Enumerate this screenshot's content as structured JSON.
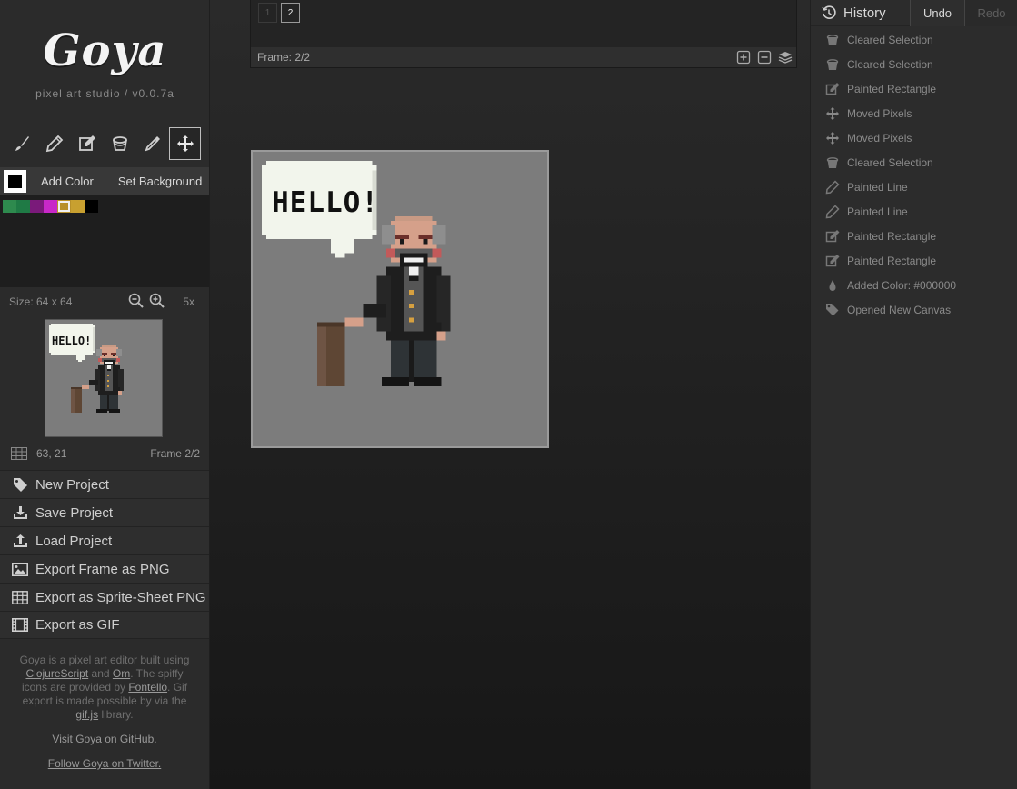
{
  "app": {
    "logo": "Goya",
    "subtitle": "pixel art studio / v0.0.7a"
  },
  "tools": [
    {
      "name": "paintbrush",
      "icon": "brush-icon",
      "active": false
    },
    {
      "name": "pencil",
      "icon": "pencil-icon",
      "active": false
    },
    {
      "name": "rectangle",
      "icon": "edit-square-icon",
      "active": false
    },
    {
      "name": "bucket",
      "icon": "bucket-icon",
      "active": false
    },
    {
      "name": "eyedropper",
      "icon": "eyedropper-icon",
      "active": false
    },
    {
      "name": "move",
      "icon": "move-icon",
      "active": true
    }
  ],
  "colors": {
    "current": "#000000",
    "add_label": "Add Color",
    "set_bg_label": "Set Background",
    "palette": [
      "#2e8a4e",
      "#1f7a45",
      "#7a1a7a",
      "#c828c8",
      "#b8902a",
      "#c8a030",
      "#000000"
    ],
    "selected_index": 4
  },
  "canvas": {
    "size_label": "Size: 64 x 64",
    "zoom": "5x",
    "coords": "63, 21",
    "frame": "Frame 2/2"
  },
  "menu": [
    {
      "label": "New Project",
      "icon": "tag-icon"
    },
    {
      "label": "Save Project",
      "icon": "download-icon"
    },
    {
      "label": "Load Project",
      "icon": "upload-icon"
    },
    {
      "label": "Export Frame as PNG",
      "icon": "image-icon"
    },
    {
      "label": "Export as Sprite-Sheet PNG",
      "icon": "grid-icon"
    },
    {
      "label": "Export as GIF",
      "icon": "film-icon"
    }
  ],
  "about": {
    "t1": "Goya is a pixel art editor built using ",
    "l1": "ClojureScript",
    "t2": " and ",
    "l2": "Om",
    "t3": ". The spiffy icons are provided by ",
    "l3": "Fontello",
    "t4": ". Gif export is made possible by via the ",
    "l4": "gif.js",
    "t5": " library.",
    "github": "Visit Goya on GitHub.",
    "twitter": "Follow Goya on Twitter."
  },
  "frames": {
    "tabs": [
      "1",
      "2"
    ],
    "active": 1,
    "footer": "Frame: 2/2"
  },
  "sprite": {
    "speech": "HELLO!"
  },
  "history": {
    "title": "History",
    "undo": "Undo",
    "redo": "Redo",
    "items": [
      {
        "label": "Cleared Selection",
        "icon": "bucket-icon"
      },
      {
        "label": "Cleared Selection",
        "icon": "bucket-icon"
      },
      {
        "label": "Painted Rectangle",
        "icon": "edit-square-icon"
      },
      {
        "label": "Moved Pixels",
        "icon": "move-icon"
      },
      {
        "label": "Moved Pixels",
        "icon": "move-icon"
      },
      {
        "label": "Cleared Selection",
        "icon": "bucket-icon"
      },
      {
        "label": "Painted Line",
        "icon": "pencil-icon"
      },
      {
        "label": "Painted Line",
        "icon": "pencil-icon"
      },
      {
        "label": "Painted Rectangle",
        "icon": "edit-square-icon"
      },
      {
        "label": "Painted Rectangle",
        "icon": "edit-square-icon"
      },
      {
        "label": "Added Color: #000000",
        "icon": "droplet-icon"
      },
      {
        "label": "Opened New Canvas",
        "icon": "tag-icon"
      }
    ]
  }
}
